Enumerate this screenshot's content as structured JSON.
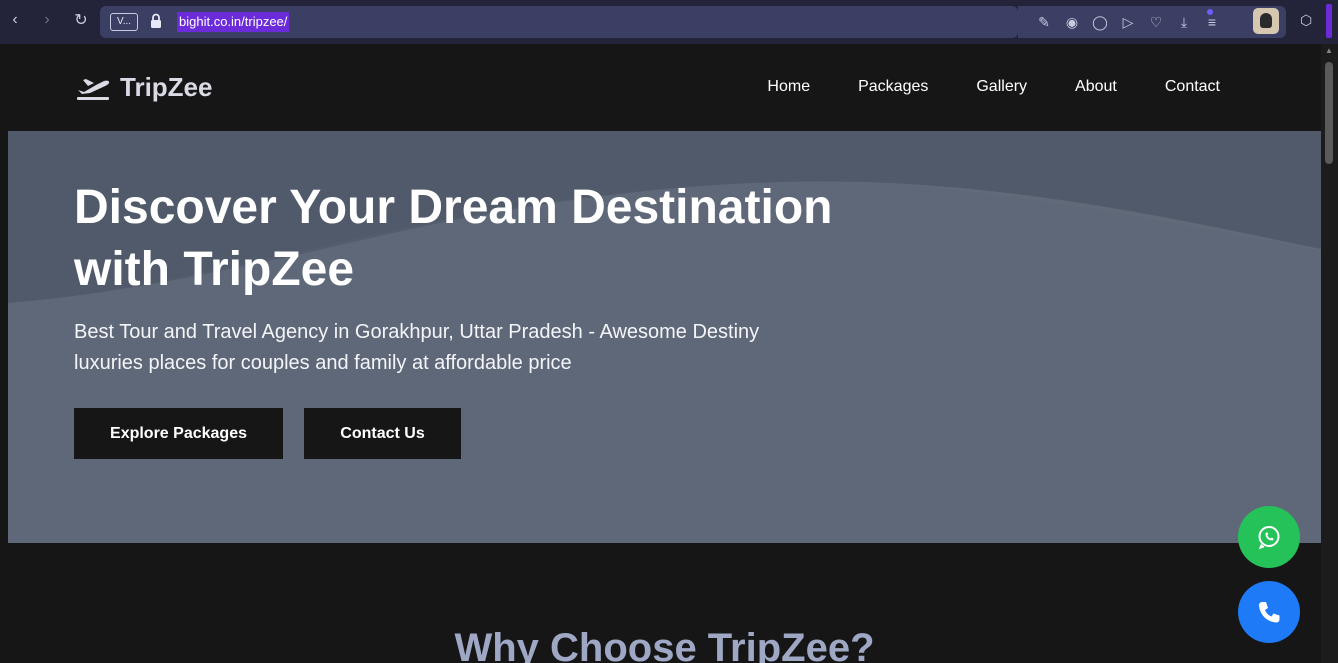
{
  "browser": {
    "tab_chip": "V...",
    "url": "bighit.co.in/tripzee/"
  },
  "site": {
    "logo_text": "TripZee",
    "nav": [
      "Home",
      "Packages",
      "Gallery",
      "About",
      "Contact"
    ]
  },
  "hero": {
    "title_line1": "Discover Your Dream Destination",
    "title_line2": "with TripZee",
    "subtitle_line1": "Best Tour and Travel Agency in Gorakhpur, Uttar Pradesh - Awesome Destiny",
    "subtitle_line2": "luxuries places for couples and family at affordable price",
    "btn_explore": "Explore Packages",
    "btn_contact": "Contact Us"
  },
  "section": {
    "why_title": "Why Choose TripZee?"
  },
  "colors": {
    "whatsapp": "#25c25a",
    "call": "#1e7af7",
    "url_highlight": "#6b2bd9"
  }
}
